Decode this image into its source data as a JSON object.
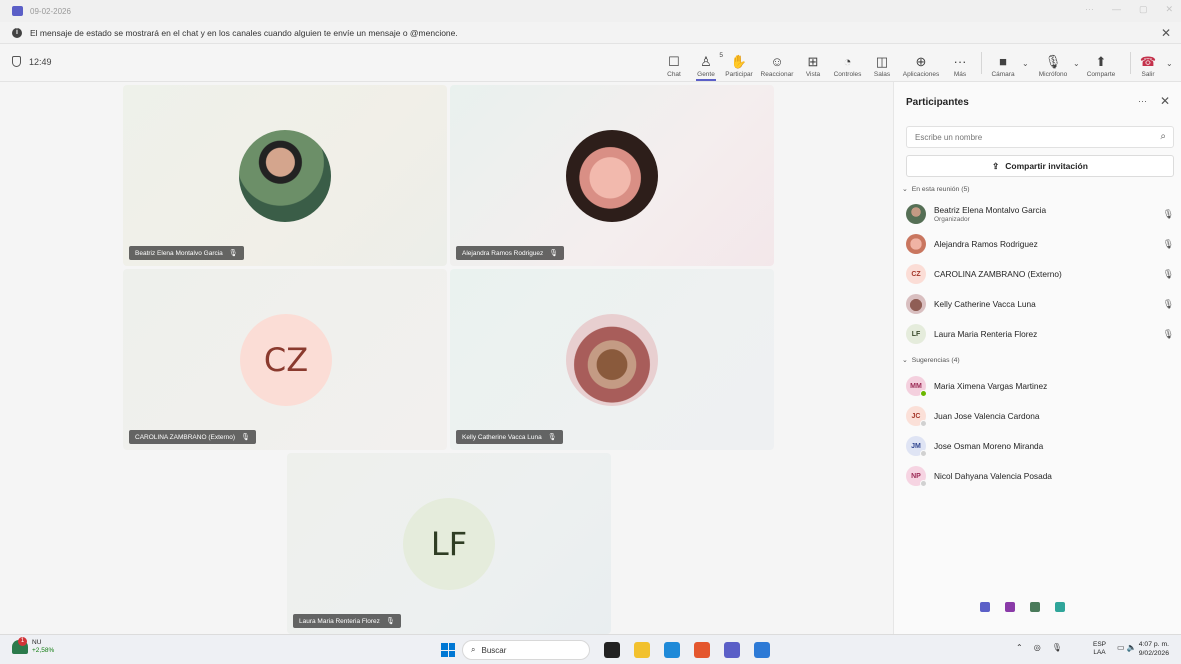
{
  "titlebar": {
    "title": "09-02-2026"
  },
  "banner": {
    "message": "El mensaje de estado se mostrará en el chat y en los canales cuando alguien te envíe un mensaje o @mencione."
  },
  "toolbar": {
    "timer": "12:49",
    "people_count": "5",
    "buttons": {
      "chat": "Chat",
      "people": "Gente",
      "raise": "Participar",
      "react": "Reaccionar",
      "view": "Vista",
      "controls": "Controles",
      "rooms": "Salas",
      "apps": "Aplicaciones",
      "more": "Más",
      "camera": "Cámara",
      "mic": "Micrófono",
      "share": "Comparte",
      "leave": "Salir"
    }
  },
  "tiles": [
    {
      "name": "Beatriz Elena Montalvo Garcia"
    },
    {
      "name": "Alejandra Ramos Rodriguez"
    },
    {
      "name": "CAROLINA ZAMBRANO (Externo)",
      "initials": "CZ"
    },
    {
      "name": "Kelly Catherine Vacca Luna"
    },
    {
      "name": "Laura Maria Renteria Florez",
      "initials": "LF"
    }
  ],
  "panel": {
    "title": "Participantes",
    "search_placeholder": "Escribe un nombre",
    "invite_label": "Compartir invitación",
    "in_meeting_label": "En esta reunión (5)",
    "suggestions_label": "Sugerencias (4)",
    "participants": [
      {
        "name": "Beatriz Elena Montalvo Garcia",
        "role": "Organizador"
      },
      {
        "name": "Alejandra Ramos Rodriguez"
      },
      {
        "name": "CAROLINA ZAMBRANO (Externo)",
        "initials": "CZ"
      },
      {
        "name": "Kelly Catherine Vacca Luna"
      },
      {
        "name": "Laura Maria Renteria Florez",
        "initials": "LF"
      }
    ],
    "suggestions": [
      {
        "name": "Maria Ximena Vargas Martinez",
        "initials": "MM"
      },
      {
        "name": "Juan Jose Valencia Cardona",
        "initials": "JC"
      },
      {
        "name": "Jose Osman Moreno Miranda",
        "initials": "JM"
      },
      {
        "name": "Nicol Dahyana Valencia Posada",
        "initials": "NP"
      }
    ]
  },
  "taskbar": {
    "weather_title": "NU",
    "weather_value": "+2,58%",
    "search_label": "Buscar",
    "lang_top": "ESP",
    "lang_bottom": "LAA",
    "time": "4:07 p. m.",
    "date": "9/02/2026"
  }
}
